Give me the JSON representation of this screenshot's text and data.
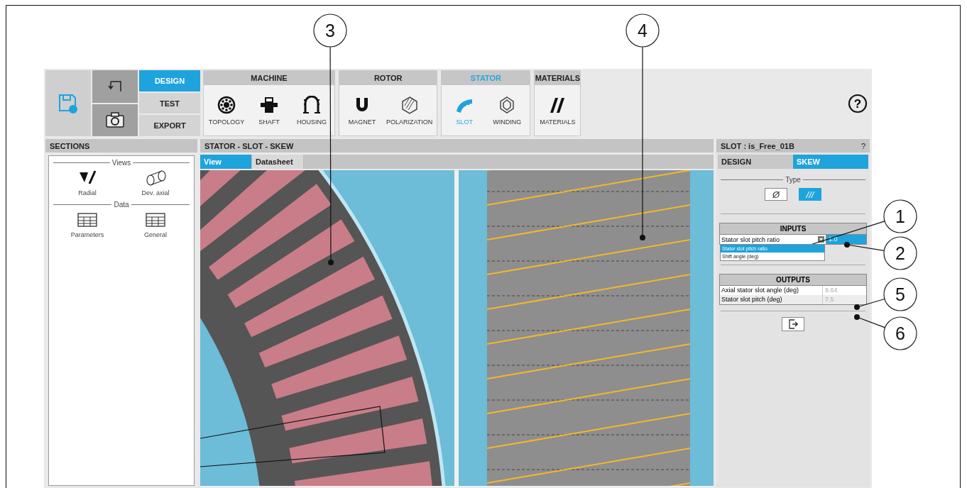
{
  "toolbar": {
    "modes": [
      {
        "label": "DESIGN",
        "selected": true
      },
      {
        "label": "TEST",
        "selected": false
      },
      {
        "label": "EXPORT",
        "selected": false
      }
    ],
    "groups": [
      {
        "title": "MACHINE",
        "selected": false,
        "items": [
          {
            "label": "TOPOLOGY",
            "kind": "topology",
            "selected": false
          },
          {
            "label": "SHAFT",
            "kind": "shaft",
            "selected": false
          },
          {
            "label": "HOUSING",
            "kind": "housing",
            "selected": false
          }
        ]
      },
      {
        "title": "ROTOR",
        "selected": false,
        "items": [
          {
            "label": "MAGNET",
            "kind": "magnet",
            "selected": false
          },
          {
            "label": "POLARIZATION",
            "kind": "polarization",
            "selected": false
          }
        ]
      },
      {
        "title": "STATOR",
        "selected": true,
        "items": [
          {
            "label": "SLOT",
            "kind": "slot",
            "selected": true
          },
          {
            "label": "WINDING",
            "kind": "winding",
            "selected": false
          }
        ]
      },
      {
        "title": "MATERIALS",
        "selected": false,
        "items": [
          {
            "label": "MATERIALS",
            "kind": "materials",
            "selected": false
          }
        ]
      }
    ],
    "help": "?"
  },
  "sections": {
    "title": "SECTIONS",
    "groups": [
      {
        "title": "Views",
        "items": [
          {
            "label": "Radial",
            "kind": "radial"
          },
          {
            "label": "Dev. axial",
            "kind": "axial"
          }
        ]
      },
      {
        "title": "Data",
        "items": [
          {
            "label": "Parameters",
            "kind": "table"
          },
          {
            "label": "General",
            "kind": "table"
          }
        ]
      }
    ]
  },
  "main": {
    "title": "STATOR - SLOT - SKEW",
    "tabs": [
      {
        "label": "View",
        "selected": true
      },
      {
        "label": "Datasheet",
        "selected": false
      }
    ]
  },
  "slot_panel": {
    "title": "SLOT : is_Free_01B",
    "help": "?",
    "tabs": [
      {
        "label": "DESIGN",
        "selected": false
      },
      {
        "label": "SKEW",
        "selected": true
      }
    ],
    "type": {
      "legend": "Type",
      "options": [
        {
          "symbol": "Ø",
          "selected": false
        },
        {
          "symbol": "///",
          "selected": true
        }
      ]
    },
    "inputs": {
      "title": "INPUTS",
      "parameter": "Stator slot pitch ratio",
      "value": "1.0",
      "dropdown": [
        {
          "label": "Stator slot pitch ratio",
          "selected": true
        },
        {
          "label": "Shift angle (deg)",
          "selected": false
        }
      ]
    },
    "outputs": {
      "title": "OUTPUTS",
      "rows": [
        {
          "label": "Axial stator slot angle (deg)",
          "value": "9.64"
        },
        {
          "label": "Stator slot pitch (deg)",
          "value": "7.5"
        }
      ]
    }
  },
  "callouts": [
    {
      "label": "1"
    },
    {
      "label": "2"
    },
    {
      "label": "3"
    },
    {
      "label": "4"
    },
    {
      "label": "5"
    },
    {
      "label": "6"
    }
  ]
}
